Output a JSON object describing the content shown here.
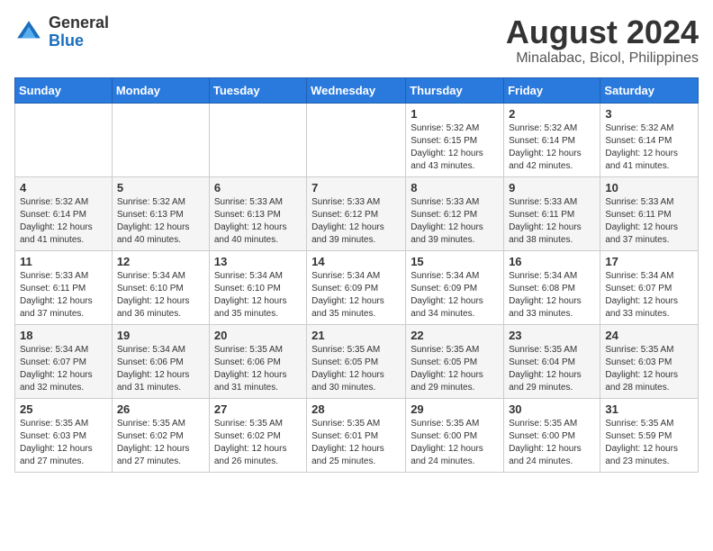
{
  "header": {
    "logo_line1": "General",
    "logo_line2": "Blue",
    "title": "August 2024",
    "subtitle": "Minalabac, Bicol, Philippines"
  },
  "weekdays": [
    "Sunday",
    "Monday",
    "Tuesday",
    "Wednesday",
    "Thursday",
    "Friday",
    "Saturday"
  ],
  "weeks": [
    [
      {
        "day": "",
        "info": ""
      },
      {
        "day": "",
        "info": ""
      },
      {
        "day": "",
        "info": ""
      },
      {
        "day": "",
        "info": ""
      },
      {
        "day": "1",
        "info": "Sunrise: 5:32 AM\nSunset: 6:15 PM\nDaylight: 12 hours\nand 43 minutes."
      },
      {
        "day": "2",
        "info": "Sunrise: 5:32 AM\nSunset: 6:14 PM\nDaylight: 12 hours\nand 42 minutes."
      },
      {
        "day": "3",
        "info": "Sunrise: 5:32 AM\nSunset: 6:14 PM\nDaylight: 12 hours\nand 41 minutes."
      }
    ],
    [
      {
        "day": "4",
        "info": "Sunrise: 5:32 AM\nSunset: 6:14 PM\nDaylight: 12 hours\nand 41 minutes."
      },
      {
        "day": "5",
        "info": "Sunrise: 5:32 AM\nSunset: 6:13 PM\nDaylight: 12 hours\nand 40 minutes."
      },
      {
        "day": "6",
        "info": "Sunrise: 5:33 AM\nSunset: 6:13 PM\nDaylight: 12 hours\nand 40 minutes."
      },
      {
        "day": "7",
        "info": "Sunrise: 5:33 AM\nSunset: 6:12 PM\nDaylight: 12 hours\nand 39 minutes."
      },
      {
        "day": "8",
        "info": "Sunrise: 5:33 AM\nSunset: 6:12 PM\nDaylight: 12 hours\nand 39 minutes."
      },
      {
        "day": "9",
        "info": "Sunrise: 5:33 AM\nSunset: 6:11 PM\nDaylight: 12 hours\nand 38 minutes."
      },
      {
        "day": "10",
        "info": "Sunrise: 5:33 AM\nSunset: 6:11 PM\nDaylight: 12 hours\nand 37 minutes."
      }
    ],
    [
      {
        "day": "11",
        "info": "Sunrise: 5:33 AM\nSunset: 6:11 PM\nDaylight: 12 hours\nand 37 minutes."
      },
      {
        "day": "12",
        "info": "Sunrise: 5:34 AM\nSunset: 6:10 PM\nDaylight: 12 hours\nand 36 minutes."
      },
      {
        "day": "13",
        "info": "Sunrise: 5:34 AM\nSunset: 6:10 PM\nDaylight: 12 hours\nand 35 minutes."
      },
      {
        "day": "14",
        "info": "Sunrise: 5:34 AM\nSunset: 6:09 PM\nDaylight: 12 hours\nand 35 minutes."
      },
      {
        "day": "15",
        "info": "Sunrise: 5:34 AM\nSunset: 6:09 PM\nDaylight: 12 hours\nand 34 minutes."
      },
      {
        "day": "16",
        "info": "Sunrise: 5:34 AM\nSunset: 6:08 PM\nDaylight: 12 hours\nand 33 minutes."
      },
      {
        "day": "17",
        "info": "Sunrise: 5:34 AM\nSunset: 6:07 PM\nDaylight: 12 hours\nand 33 minutes."
      }
    ],
    [
      {
        "day": "18",
        "info": "Sunrise: 5:34 AM\nSunset: 6:07 PM\nDaylight: 12 hours\nand 32 minutes."
      },
      {
        "day": "19",
        "info": "Sunrise: 5:34 AM\nSunset: 6:06 PM\nDaylight: 12 hours\nand 31 minutes."
      },
      {
        "day": "20",
        "info": "Sunrise: 5:35 AM\nSunset: 6:06 PM\nDaylight: 12 hours\nand 31 minutes."
      },
      {
        "day": "21",
        "info": "Sunrise: 5:35 AM\nSunset: 6:05 PM\nDaylight: 12 hours\nand 30 minutes."
      },
      {
        "day": "22",
        "info": "Sunrise: 5:35 AM\nSunset: 6:05 PM\nDaylight: 12 hours\nand 29 minutes."
      },
      {
        "day": "23",
        "info": "Sunrise: 5:35 AM\nSunset: 6:04 PM\nDaylight: 12 hours\nand 29 minutes."
      },
      {
        "day": "24",
        "info": "Sunrise: 5:35 AM\nSunset: 6:03 PM\nDaylight: 12 hours\nand 28 minutes."
      }
    ],
    [
      {
        "day": "25",
        "info": "Sunrise: 5:35 AM\nSunset: 6:03 PM\nDaylight: 12 hours\nand 27 minutes."
      },
      {
        "day": "26",
        "info": "Sunrise: 5:35 AM\nSunset: 6:02 PM\nDaylight: 12 hours\nand 27 minutes."
      },
      {
        "day": "27",
        "info": "Sunrise: 5:35 AM\nSunset: 6:02 PM\nDaylight: 12 hours\nand 26 minutes."
      },
      {
        "day": "28",
        "info": "Sunrise: 5:35 AM\nSunset: 6:01 PM\nDaylight: 12 hours\nand 25 minutes."
      },
      {
        "day": "29",
        "info": "Sunrise: 5:35 AM\nSunset: 6:00 PM\nDaylight: 12 hours\nand 24 minutes."
      },
      {
        "day": "30",
        "info": "Sunrise: 5:35 AM\nSunset: 6:00 PM\nDaylight: 12 hours\nand 24 minutes."
      },
      {
        "day": "31",
        "info": "Sunrise: 5:35 AM\nSunset: 5:59 PM\nDaylight: 12 hours\nand 23 minutes."
      }
    ]
  ]
}
